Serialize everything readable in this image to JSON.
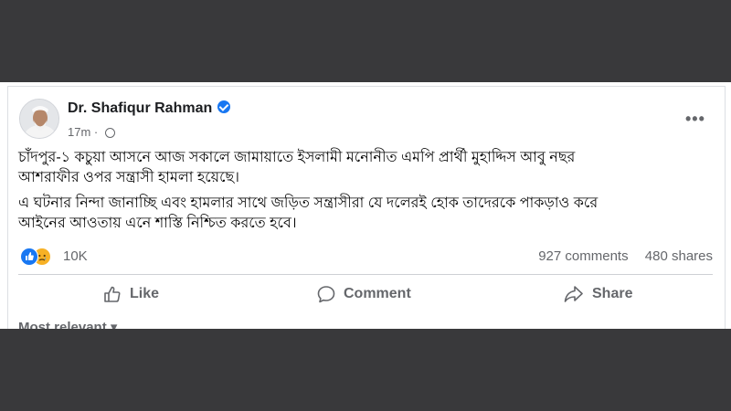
{
  "post": {
    "author": "Dr. Shafiqur Rahman",
    "time": "17m",
    "time_separator": "·",
    "more_options": "•••",
    "paragraph_1_line_1": "চাঁদপুর-১ কচুয়া আসনে আজ সকালে জামায়াতে ইসলামী মনোনীত এমপি প্রার্থী মুহাদ্দিস আবু নছর",
    "paragraph_1_line_2": "আশরাফীর ওপর সন্ত্রাসী হামলা হয়েছে।",
    "paragraph_2_line_1": "এ ঘটনার নিন্দা জানাচ্ছি এবং হামলার সাথে জড়িত সন্ত্রাসীরা যে দলেরই হোক তাদেরকে পাকড়াও করে",
    "paragraph_2_line_2": "আইনের আওতায় এনে শাস্তি নিশ্চিত করতে হবে।"
  },
  "engagement": {
    "reaction_count": "10K",
    "comments": "927 comments",
    "shares": "480 shares"
  },
  "actions": {
    "like": "Like",
    "comment": "Comment",
    "share": "Share"
  },
  "comments_filter": "Most relevant",
  "colors": {
    "accent": "#1877f2",
    "muted_text": "#65676b",
    "background_band": "#39393b"
  }
}
